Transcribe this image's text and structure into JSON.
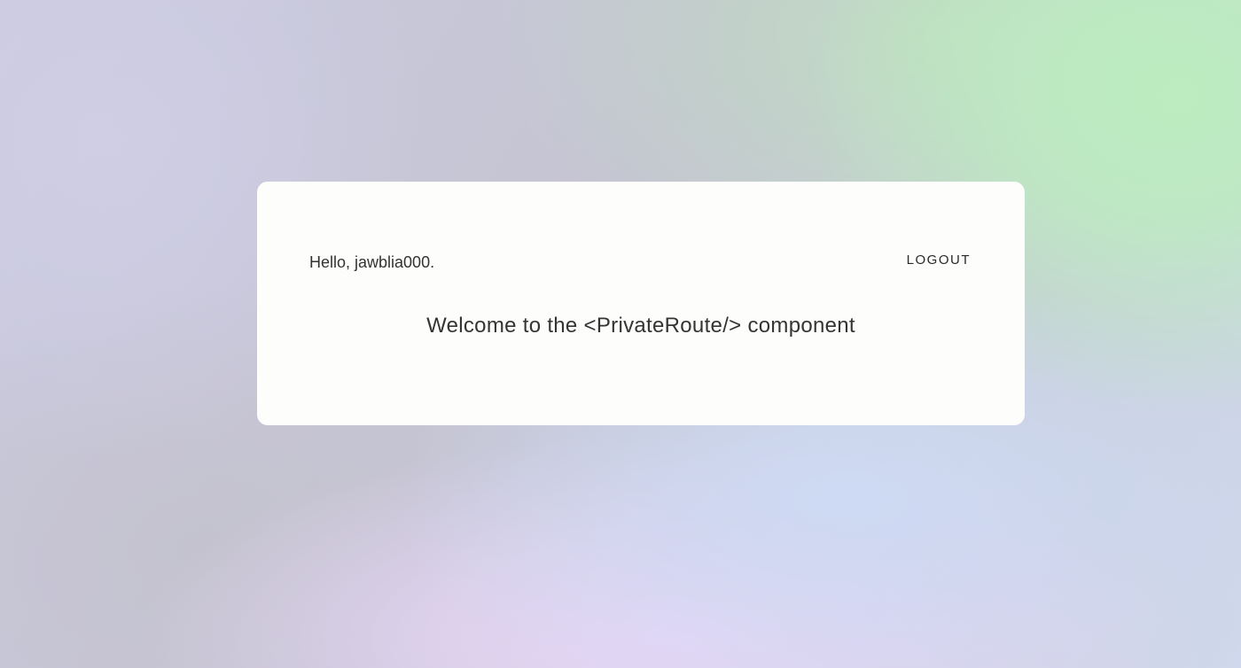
{
  "card": {
    "greeting": "Hello, jawblia000.",
    "logout_label": "LOGOUT",
    "welcome_message": "Welcome to the <PrivateRoute/> component"
  },
  "colors": {
    "card_background": "#fdfdfc",
    "text_primary": "#333333",
    "background_green": "#bcecc0",
    "background_lavender": "#e6d6f6",
    "background_blue": "#cedaf4"
  }
}
